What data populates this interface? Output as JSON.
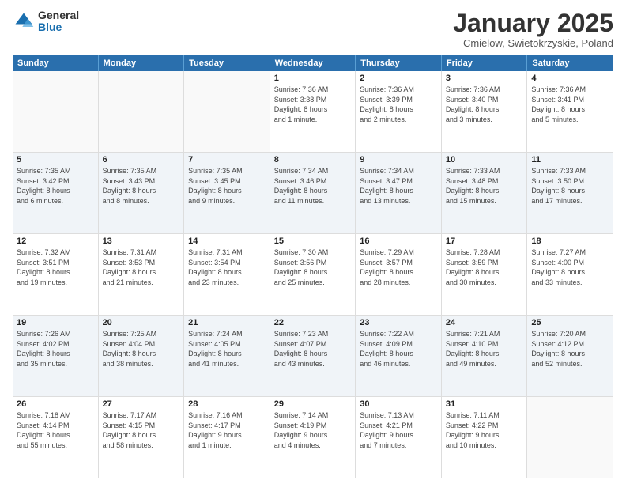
{
  "logo": {
    "general": "General",
    "blue": "Blue"
  },
  "title": "January 2025",
  "location": "Cmielow, Swietokrzyskie, Poland",
  "days": [
    "Sunday",
    "Monday",
    "Tuesday",
    "Wednesday",
    "Thursday",
    "Friday",
    "Saturday"
  ],
  "rows": [
    [
      {
        "day": "",
        "detail": ""
      },
      {
        "day": "",
        "detail": ""
      },
      {
        "day": "",
        "detail": ""
      },
      {
        "day": "1",
        "detail": "Sunrise: 7:36 AM\nSunset: 3:38 PM\nDaylight: 8 hours\nand 1 minute."
      },
      {
        "day": "2",
        "detail": "Sunrise: 7:36 AM\nSunset: 3:39 PM\nDaylight: 8 hours\nand 2 minutes."
      },
      {
        "day": "3",
        "detail": "Sunrise: 7:36 AM\nSunset: 3:40 PM\nDaylight: 8 hours\nand 3 minutes."
      },
      {
        "day": "4",
        "detail": "Sunrise: 7:36 AM\nSunset: 3:41 PM\nDaylight: 8 hours\nand 5 minutes."
      }
    ],
    [
      {
        "day": "5",
        "detail": "Sunrise: 7:35 AM\nSunset: 3:42 PM\nDaylight: 8 hours\nand 6 minutes."
      },
      {
        "day": "6",
        "detail": "Sunrise: 7:35 AM\nSunset: 3:43 PM\nDaylight: 8 hours\nand 8 minutes."
      },
      {
        "day": "7",
        "detail": "Sunrise: 7:35 AM\nSunset: 3:45 PM\nDaylight: 8 hours\nand 9 minutes."
      },
      {
        "day": "8",
        "detail": "Sunrise: 7:34 AM\nSunset: 3:46 PM\nDaylight: 8 hours\nand 11 minutes."
      },
      {
        "day": "9",
        "detail": "Sunrise: 7:34 AM\nSunset: 3:47 PM\nDaylight: 8 hours\nand 13 minutes."
      },
      {
        "day": "10",
        "detail": "Sunrise: 7:33 AM\nSunset: 3:48 PM\nDaylight: 8 hours\nand 15 minutes."
      },
      {
        "day": "11",
        "detail": "Sunrise: 7:33 AM\nSunset: 3:50 PM\nDaylight: 8 hours\nand 17 minutes."
      }
    ],
    [
      {
        "day": "12",
        "detail": "Sunrise: 7:32 AM\nSunset: 3:51 PM\nDaylight: 8 hours\nand 19 minutes."
      },
      {
        "day": "13",
        "detail": "Sunrise: 7:31 AM\nSunset: 3:53 PM\nDaylight: 8 hours\nand 21 minutes."
      },
      {
        "day": "14",
        "detail": "Sunrise: 7:31 AM\nSunset: 3:54 PM\nDaylight: 8 hours\nand 23 minutes."
      },
      {
        "day": "15",
        "detail": "Sunrise: 7:30 AM\nSunset: 3:56 PM\nDaylight: 8 hours\nand 25 minutes."
      },
      {
        "day": "16",
        "detail": "Sunrise: 7:29 AM\nSunset: 3:57 PM\nDaylight: 8 hours\nand 28 minutes."
      },
      {
        "day": "17",
        "detail": "Sunrise: 7:28 AM\nSunset: 3:59 PM\nDaylight: 8 hours\nand 30 minutes."
      },
      {
        "day": "18",
        "detail": "Sunrise: 7:27 AM\nSunset: 4:00 PM\nDaylight: 8 hours\nand 33 minutes."
      }
    ],
    [
      {
        "day": "19",
        "detail": "Sunrise: 7:26 AM\nSunset: 4:02 PM\nDaylight: 8 hours\nand 35 minutes."
      },
      {
        "day": "20",
        "detail": "Sunrise: 7:25 AM\nSunset: 4:04 PM\nDaylight: 8 hours\nand 38 minutes."
      },
      {
        "day": "21",
        "detail": "Sunrise: 7:24 AM\nSunset: 4:05 PM\nDaylight: 8 hours\nand 41 minutes."
      },
      {
        "day": "22",
        "detail": "Sunrise: 7:23 AM\nSunset: 4:07 PM\nDaylight: 8 hours\nand 43 minutes."
      },
      {
        "day": "23",
        "detail": "Sunrise: 7:22 AM\nSunset: 4:09 PM\nDaylight: 8 hours\nand 46 minutes."
      },
      {
        "day": "24",
        "detail": "Sunrise: 7:21 AM\nSunset: 4:10 PM\nDaylight: 8 hours\nand 49 minutes."
      },
      {
        "day": "25",
        "detail": "Sunrise: 7:20 AM\nSunset: 4:12 PM\nDaylight: 8 hours\nand 52 minutes."
      }
    ],
    [
      {
        "day": "26",
        "detail": "Sunrise: 7:18 AM\nSunset: 4:14 PM\nDaylight: 8 hours\nand 55 minutes."
      },
      {
        "day": "27",
        "detail": "Sunrise: 7:17 AM\nSunset: 4:15 PM\nDaylight: 8 hours\nand 58 minutes."
      },
      {
        "day": "28",
        "detail": "Sunrise: 7:16 AM\nSunset: 4:17 PM\nDaylight: 9 hours\nand 1 minute."
      },
      {
        "day": "29",
        "detail": "Sunrise: 7:14 AM\nSunset: 4:19 PM\nDaylight: 9 hours\nand 4 minutes."
      },
      {
        "day": "30",
        "detail": "Sunrise: 7:13 AM\nSunset: 4:21 PM\nDaylight: 9 hours\nand 7 minutes."
      },
      {
        "day": "31",
        "detail": "Sunrise: 7:11 AM\nSunset: 4:22 PM\nDaylight: 9 hours\nand 10 minutes."
      },
      {
        "day": "",
        "detail": ""
      }
    ]
  ]
}
